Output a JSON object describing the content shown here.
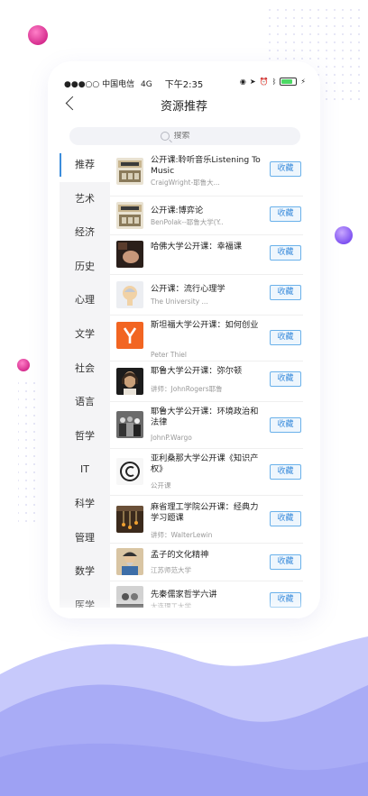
{
  "status": {
    "carrier": "●●●○○ 中国电信",
    "network": "4G",
    "time": "下午2:35",
    "battery_percent": 80
  },
  "nav": {
    "title": "资源推荐"
  },
  "search": {
    "placeholder": "搜索"
  },
  "sidebar": {
    "items": [
      "推荐",
      "艺术",
      "经济",
      "历史",
      "心理",
      "文学",
      "社会",
      "语言",
      "哲学",
      "IT",
      "科学",
      "管理",
      "数学",
      "医学"
    ]
  },
  "courses": [
    {
      "title": "公开课:聆听音乐Listening To Music",
      "subtitle": "CraigWright-耶鲁大...",
      "button": "收藏",
      "thumb": "yale-book"
    },
    {
      "title": "公开课:博弈论",
      "subtitle": "BenPolak--耶鲁大学(Y...",
      "button": "收藏",
      "thumb": "yale-book"
    },
    {
      "title": "哈佛大学公开课：幸福课",
      "subtitle": "",
      "button": "收藏",
      "thumb": "dark-photo"
    },
    {
      "title": "公开课：流行心理学",
      "subtitle": "The University ...",
      "button": "收藏",
      "thumb": "head-icon"
    },
    {
      "title": "斯坦福大学公开课：如何创业",
      "subtitle": "Peter Thiel",
      "button": "收藏",
      "thumb": "y-logo"
    },
    {
      "title": "耶鲁大学公开课：弥尔顿",
      "subtitle": "讲师：JohnRogers耶鲁...",
      "button": "收藏",
      "thumb": "portrait"
    },
    {
      "title": "耶鲁大学公开课：环境政治和法律",
      "subtitle": "JohnP.Wargo",
      "button": "收藏",
      "thumb": "crowd"
    },
    {
      "title": "亚利桑那大学公开课《知识产权》",
      "subtitle": "公开课",
      "button": "收藏",
      "thumb": "copyright"
    },
    {
      "title": "麻省理工学院公开课：经典力学习题课",
      "subtitle": "讲师：WalterLewin",
      "button": "收藏",
      "thumb": "pendulum"
    },
    {
      "title": "孟子的文化精神",
      "subtitle": "江苏师范大学",
      "button": "收藏",
      "thumb": "sage"
    },
    {
      "title": "先秦儒家哲学六讲",
      "subtitle": "大连理工大学",
      "button": "收藏",
      "thumb": "scroll"
    }
  ],
  "colors": {
    "accent": "#3c8ddc",
    "wave": "#a3a6f5",
    "orb_pink": "#e8409a",
    "orb_purple": "#9b6df5"
  }
}
